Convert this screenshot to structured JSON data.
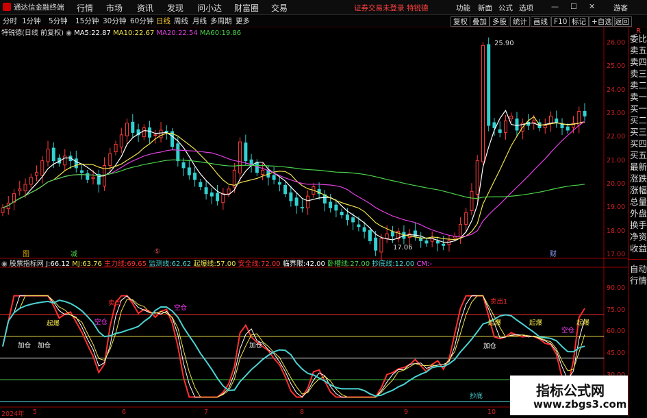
{
  "app": {
    "title": "通达信金融终端",
    "menu": [
      "行情",
      "市场",
      "资讯",
      "发现",
      "问小达",
      "财富圈",
      "交易"
    ],
    "notice": "证券交易未登录",
    "stock_tag": "特锐德",
    "right_menu": [
      "功能",
      "新面",
      "公式",
      "选项"
    ],
    "guest": "游客",
    "win_controls": [
      "—",
      "☐",
      "✕"
    ]
  },
  "toolbar": {
    "periods": [
      "分时",
      "1分钟",
      "5分钟",
      "15分钟",
      "30分钟",
      "60分钟",
      "日线",
      "周线",
      "月线",
      "多周期",
      "更多"
    ],
    "active_period": "日线",
    "buttons": [
      "复权",
      "叠加",
      "多股",
      "统计",
      "画线",
      "F10",
      "标记",
      "+自选",
      "返回"
    ]
  },
  "main_chart": {
    "stock_label": "特锐德(日线 前复权)",
    "ma": [
      {
        "label": "MA5:",
        "value": "22.87",
        "color": "#ffffff"
      },
      {
        "label": "MA10:",
        "value": "22.67",
        "color": "#f1e34b"
      },
      {
        "label": "MA20:",
        "value": "22.54",
        "color": "#e040e0"
      },
      {
        "label": "MA60:",
        "value": "19.86",
        "color": "#4bd34b"
      }
    ],
    "y_ticks": [
      "26.00",
      "25.00",
      "24.00",
      "23.00",
      "22.00",
      "21.00",
      "20.00",
      "19.00",
      "18.00",
      "17.00"
    ],
    "high_label": "25.90",
    "low_label": "17.06",
    "event_marks": [
      {
        "text": "图",
        "color": "#d9a800"
      },
      {
        "text": "减",
        "color": "#4bd34b"
      },
      {
        "text": "⑤",
        "color": "#e05050"
      },
      {
        "text": "财",
        "color": "#8fa8ff"
      }
    ]
  },
  "indicator": {
    "name": "股票指标网",
    "fields": [
      {
        "label": "J:",
        "value": "66.12",
        "color": "#ffffff"
      },
      {
        "label": "MJ:",
        "value": "63.76",
        "color": "#f1e34b"
      },
      {
        "label": "主力线:",
        "value": "69.65",
        "color": "#ff3030"
      },
      {
        "label": "监测线:",
        "value": "62.62",
        "color": "#4bd3d3"
      },
      {
        "label": "起爆线:",
        "value": "57.00",
        "color": "#f1e34b"
      },
      {
        "label": "安全线:",
        "value": "72.00",
        "color": "#ff3030"
      },
      {
        "label": "临界限:",
        "value": "42.00",
        "color": "#ffffff"
      },
      {
        "label": "卧槽线:",
        "value": "27.00",
        "color": "#4bd34b"
      },
      {
        "label": "抄底线:",
        "value": "12.00",
        "color": "#4bd3d3"
      },
      {
        "label": "CM:",
        "value": "-",
        "color": "#ff40ff"
      }
    ],
    "y_ticks": [
      "90.00",
      "75.00",
      "60.00",
      "45.00",
      "30.00"
    ],
    "signals": [
      "加仓",
      "加仓",
      "起爆",
      "卖出",
      "空仓",
      "空仓",
      "加仓",
      "加仓",
      "抄底",
      "加仓",
      "卖出1",
      "起爆",
      "起爆",
      "起爆",
      "空仓"
    ]
  },
  "x_axis": [
    "2024年",
    "5",
    "6",
    "7",
    "8",
    "9",
    "10"
  ],
  "right_panel": {
    "top": "R",
    "items": [
      "委比",
      "卖五",
      "卖四",
      "卖三",
      "卖二",
      "卖一",
      "买一",
      "买二",
      "买三",
      "买四",
      "买五",
      "最新",
      "涨跌",
      "涨幅",
      "总量",
      "外盘",
      "换手",
      "净资",
      "收益"
    ],
    "bottom": [
      "自动",
      "行情"
    ]
  },
  "watermark": {
    "title": "指标公式网",
    "url": "www.zbgs3.com"
  },
  "chart_data": {
    "type": "candlestick",
    "title": "特锐德(日线 前复权)",
    "ylim": [
      17.0,
      26.2
    ],
    "x_labels": [
      "2024年",
      "5",
      "6",
      "7",
      "8",
      "9",
      "10"
    ],
    "closes": [
      19.0,
      19.2,
      19.6,
      19.8,
      20.0,
      20.3,
      20.5,
      21.0,
      21.5,
      21.0,
      20.9,
      21.2,
      21.0,
      20.7,
      20.5,
      20.2,
      20.3,
      20.0,
      20.8,
      21.3,
      21.7,
      22.1,
      22.6,
      22.2,
      22.1,
      22.4,
      22.0,
      22.1,
      22.3,
      22.2,
      21.6,
      21.0,
      20.7,
      20.4,
      20.2,
      19.9,
      19.6,
      19.5,
      19.3,
      19.6,
      19.8,
      20.6,
      21.8,
      21.0,
      20.8,
      20.5,
      20.6,
      20.3,
      20.2,
      20.0,
      19.6,
      19.3,
      19.1,
      19.0,
      19.5,
      19.9,
      19.6,
      19.2,
      19.0,
      18.9,
      18.7,
      18.5,
      18.4,
      18.2,
      18.0,
      17.6,
      17.2,
      17.7,
      17.9,
      17.8,
      18.0,
      17.7,
      17.9,
      17.8,
      17.6,
      17.5,
      17.7,
      17.5,
      17.4,
      17.6,
      17.8,
      18.3,
      18.8,
      19.7,
      21.0,
      25.9,
      22.5,
      22.4,
      22.2,
      22.7,
      22.9,
      22.3,
      22.6,
      22.5,
      22.7,
      22.4,
      22.5,
      22.9,
      22.6,
      22.4,
      22.3,
      22.6,
      23.1,
      22.9
    ],
    "ma_values": {
      "MA5": 22.87,
      "MA10": 22.67,
      "MA20": 22.54,
      "MA60": 19.86
    },
    "high": 25.9,
    "low": 17.06
  }
}
